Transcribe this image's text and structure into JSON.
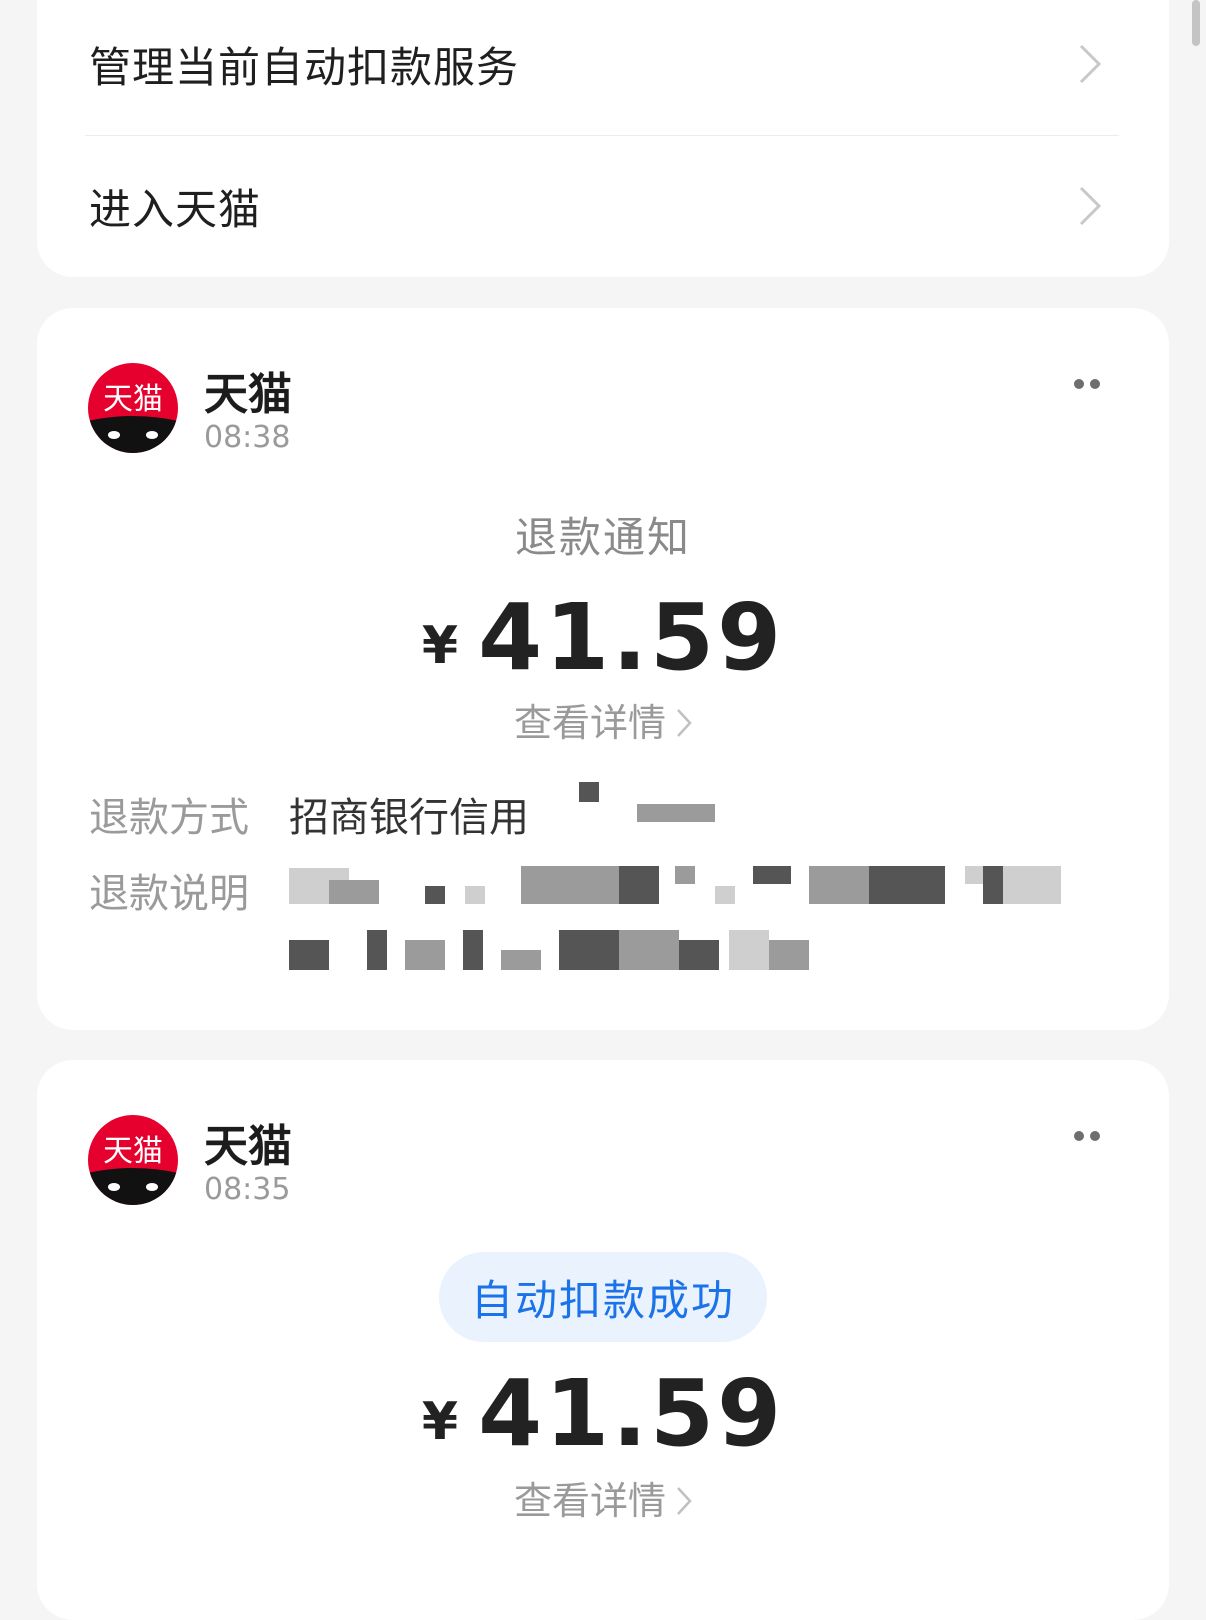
{
  "menu": {
    "items": [
      {
        "label": "管理当前自动扣款服务"
      },
      {
        "label": "进入天猫"
      }
    ]
  },
  "messages": [
    {
      "sender": "天猫",
      "avatar_text": "天猫",
      "time": "08:38",
      "title": "退款通知",
      "currency": "¥",
      "amount": "41.59",
      "detail_label": "查看详情",
      "fields": [
        {
          "key": "退款方式",
          "value": "招商银行信用"
        },
        {
          "key": "退款说明",
          "value": ""
        }
      ]
    },
    {
      "sender": "天猫",
      "avatar_text": "天猫",
      "time": "08:35",
      "status": "自动扣款成功",
      "currency": "¥",
      "amount": "41.59",
      "detail_label": "查看详情"
    }
  ],
  "colors": {
    "background": "#f5f5f5",
    "card": "#ffffff",
    "brand_red": "#e5002d",
    "status_blue": "#1a73e8",
    "status_bg": "#eaf2fe"
  },
  "icons": {
    "chevron": "chevron-right-icon",
    "more": "more-dots-icon",
    "avatar": "tmall-logo-icon"
  }
}
